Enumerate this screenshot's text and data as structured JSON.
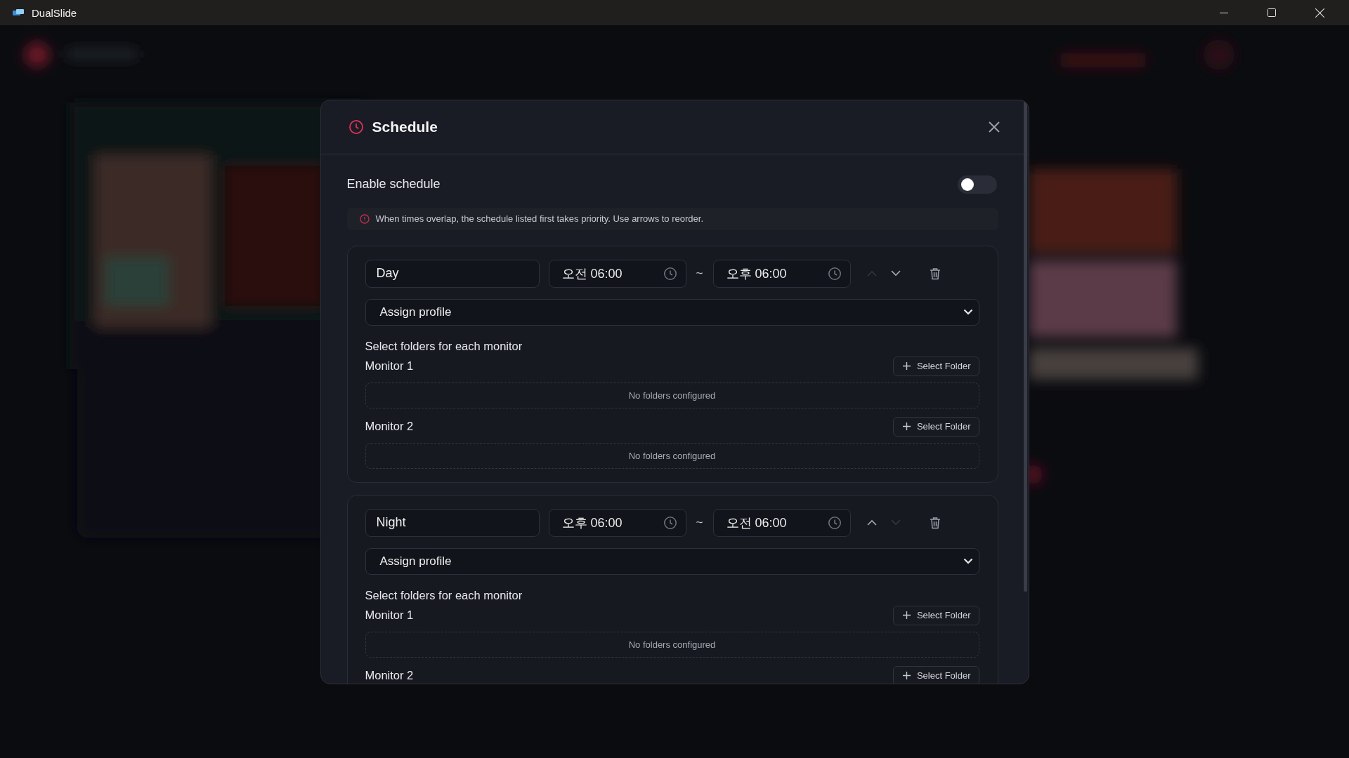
{
  "window": {
    "title": "DualSlide"
  },
  "dialog": {
    "title": "Schedule",
    "enable_label": "Enable schedule",
    "enabled": false,
    "notice": "When times overlap, the schedule listed first takes priority. Use arrows to reorder.",
    "schedules": [
      {
        "name": "Day",
        "start": "오전 06:00",
        "separator": "~",
        "end": "오후 06:00",
        "move_up_disabled": true,
        "move_down_disabled": false,
        "profile": "Assign profile",
        "folders_heading": "Select folders for each monitor",
        "monitors": [
          {
            "label": "Monitor 1",
            "button": "Select Folder",
            "empty_text": "No folders configured"
          },
          {
            "label": "Monitor 2",
            "button": "Select Folder",
            "empty_text": "No folders configured"
          }
        ]
      },
      {
        "name": "Night",
        "start": "오후 06:00",
        "separator": "~",
        "end": "오전 06:00",
        "move_up_disabled": false,
        "move_down_disabled": true,
        "profile": "Assign profile",
        "folders_heading": "Select folders for each monitor",
        "monitors": [
          {
            "label": "Monitor 1",
            "button": "Select Folder",
            "empty_text": "No folders configured"
          },
          {
            "label": "Monitor 2",
            "button": "Select Folder"
          }
        ]
      }
    ]
  }
}
